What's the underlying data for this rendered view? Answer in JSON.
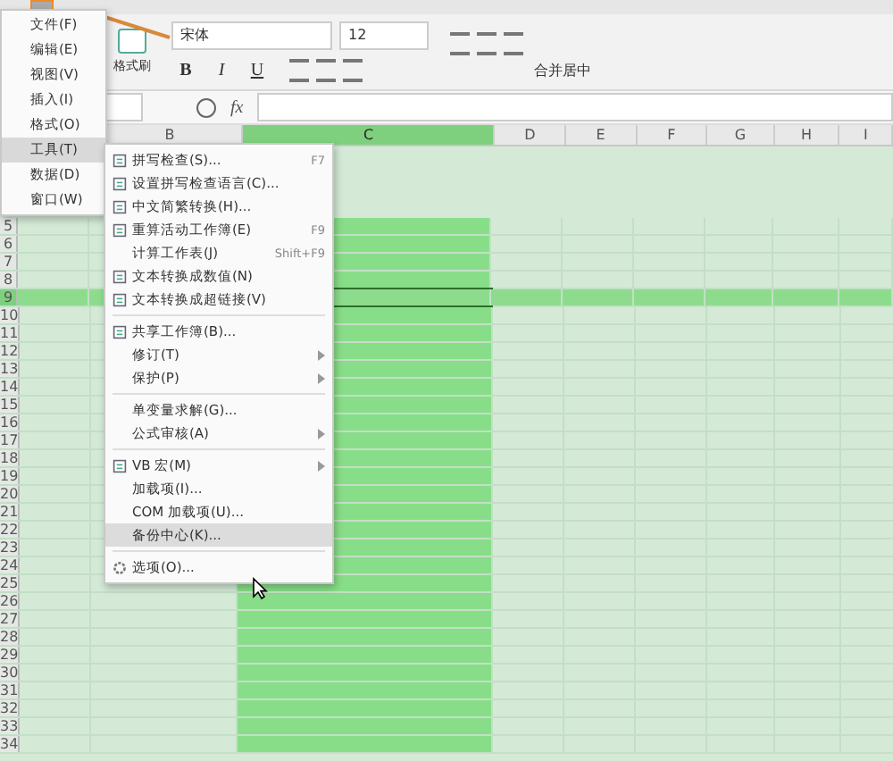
{
  "ribbon": {
    "format_painter": "格式刷",
    "font_name": "宋体",
    "font_size": "12",
    "bold": "B",
    "italic": "I",
    "underline": "U",
    "merge": "合并居中"
  },
  "formula_bar": {
    "fx": "fx"
  },
  "columns": [
    {
      "label": "B",
      "selected": false
    },
    {
      "label": "C",
      "selected": true
    },
    {
      "label": "D",
      "selected": false
    },
    {
      "label": "E",
      "selected": false
    },
    {
      "label": "F",
      "selected": false
    },
    {
      "label": "G",
      "selected": false
    },
    {
      "label": "H",
      "selected": false
    },
    {
      "label": "I",
      "selected": false
    }
  ],
  "rows": [
    {
      "label": "5",
      "selected": false
    },
    {
      "label": "6",
      "selected": false
    },
    {
      "label": "7",
      "selected": false
    },
    {
      "label": "8",
      "selected": false
    },
    {
      "label": "9",
      "selected": true
    },
    {
      "label": "10",
      "selected": false
    },
    {
      "label": "11",
      "selected": false
    },
    {
      "label": "12",
      "selected": false
    },
    {
      "label": "13",
      "selected": false
    },
    {
      "label": "14",
      "selected": false
    },
    {
      "label": "15",
      "selected": false
    },
    {
      "label": "16",
      "selected": false
    },
    {
      "label": "17",
      "selected": false
    },
    {
      "label": "18",
      "selected": false
    },
    {
      "label": "19",
      "selected": false
    },
    {
      "label": "20",
      "selected": false
    },
    {
      "label": "21",
      "selected": false
    },
    {
      "label": "22",
      "selected": false
    },
    {
      "label": "23",
      "selected": false
    },
    {
      "label": "24",
      "selected": false
    },
    {
      "label": "25",
      "selected": false
    },
    {
      "label": "26",
      "selected": false
    },
    {
      "label": "27",
      "selected": false
    },
    {
      "label": "28",
      "selected": false
    },
    {
      "label": "29",
      "selected": false
    },
    {
      "label": "30",
      "selected": false
    },
    {
      "label": "31",
      "selected": false
    },
    {
      "label": "32",
      "selected": false
    },
    {
      "label": "33",
      "selected": false
    },
    {
      "label": "34",
      "selected": false
    }
  ],
  "main_menu": [
    {
      "label": "文件(F)",
      "selected": false
    },
    {
      "label": "编辑(E)",
      "selected": false
    },
    {
      "label": "视图(V)",
      "selected": false
    },
    {
      "label": "插入(I)",
      "selected": false
    },
    {
      "label": "格式(O)",
      "selected": false
    },
    {
      "label": "工具(T)",
      "selected": true
    },
    {
      "label": "数据(D)",
      "selected": false
    },
    {
      "label": "窗口(W)",
      "selected": false
    }
  ],
  "tools_menu": [
    {
      "kind": "item",
      "label": "拼写检查(S)...",
      "shortcut": "F7",
      "has_icon": true,
      "submenu": false,
      "hovered": false
    },
    {
      "kind": "item",
      "label": "设置拼写检查语言(C)...",
      "has_icon": true,
      "submenu": false,
      "hovered": false
    },
    {
      "kind": "item",
      "label": "中文简繁转换(H)...",
      "has_icon": true,
      "submenu": false,
      "hovered": false
    },
    {
      "kind": "item",
      "label": "重算活动工作簿(E)",
      "shortcut": "F9",
      "has_icon": true,
      "submenu": false,
      "hovered": false
    },
    {
      "kind": "item",
      "label": "计算工作表(J)",
      "shortcut": "Shift+F9",
      "has_icon": false,
      "submenu": false,
      "hovered": false
    },
    {
      "kind": "item",
      "label": "文本转换成数值(N)",
      "has_icon": true,
      "submenu": false,
      "hovered": false
    },
    {
      "kind": "item",
      "label": "文本转换成超链接(V)",
      "has_icon": true,
      "submenu": false,
      "hovered": false
    },
    {
      "kind": "separator"
    },
    {
      "kind": "item",
      "label": "共享工作簿(B)...",
      "has_icon": true,
      "submenu": false,
      "hovered": false
    },
    {
      "kind": "item",
      "label": "修订(T)",
      "has_icon": false,
      "submenu": true,
      "hovered": false
    },
    {
      "kind": "item",
      "label": "保护(P)",
      "has_icon": false,
      "submenu": true,
      "hovered": false
    },
    {
      "kind": "separator"
    },
    {
      "kind": "item",
      "label": "单变量求解(G)...",
      "has_icon": false,
      "submenu": false,
      "hovered": false
    },
    {
      "kind": "item",
      "label": "公式审核(A)",
      "has_icon": false,
      "submenu": true,
      "hovered": false
    },
    {
      "kind": "separator"
    },
    {
      "kind": "item",
      "label": "VB 宏(M)",
      "has_icon": true,
      "submenu": true,
      "hovered": false
    },
    {
      "kind": "item",
      "label": "加载项(I)...",
      "has_icon": false,
      "submenu": false,
      "hovered": false
    },
    {
      "kind": "item",
      "label": "COM 加载项(U)...",
      "has_icon": false,
      "submenu": false,
      "hovered": false
    },
    {
      "kind": "item",
      "label": "备份中心(K)...",
      "has_icon": false,
      "submenu": false,
      "hovered": true
    },
    {
      "kind": "separator"
    },
    {
      "kind": "item",
      "label": "选项(O)...",
      "has_icon": true,
      "submenu": false,
      "hovered": false
    }
  ]
}
